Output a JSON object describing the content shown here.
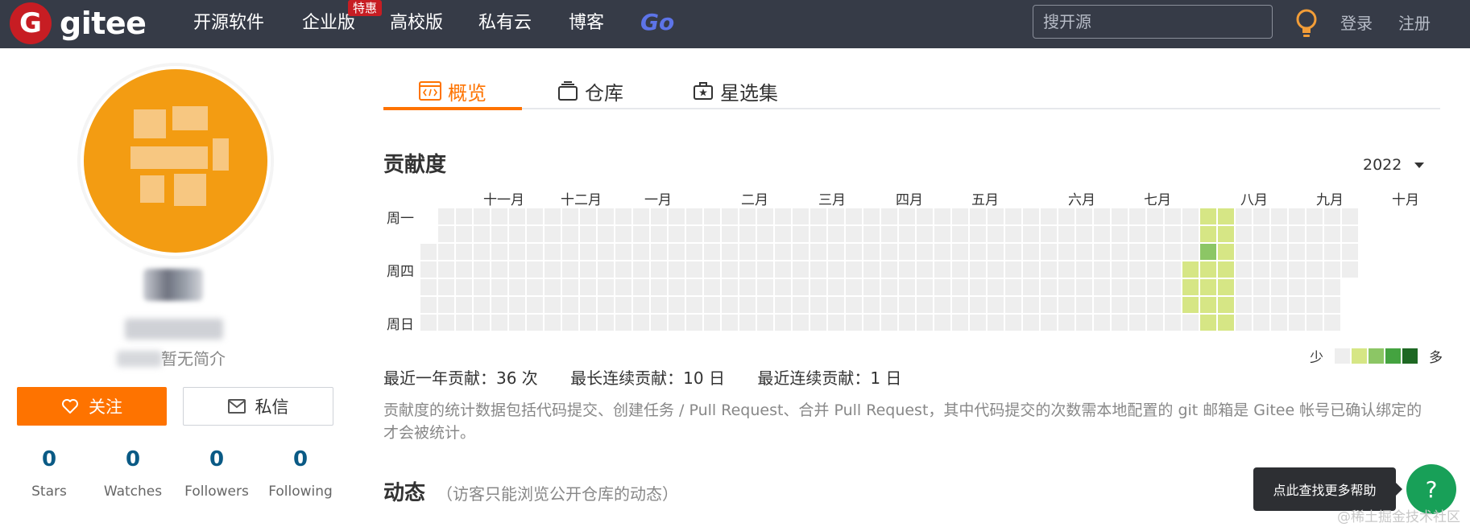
{
  "navbar": {
    "logo_text": "gitee",
    "logo_badge": "G",
    "items": [
      "开源软件",
      "企业版",
      "高校版",
      "私有云",
      "博客"
    ],
    "enterprise_badge": "特惠",
    "go_label": "Go",
    "search_placeholder": "搜开源",
    "login": "登录",
    "register": "注册"
  },
  "profile": {
    "bio": "暂无简介",
    "follow_label": "关注",
    "message_label": "私信",
    "stats": [
      {
        "value": "0",
        "label": "Stars"
      },
      {
        "value": "0",
        "label": "Watches"
      },
      {
        "value": "0",
        "label": "Followers"
      },
      {
        "value": "0",
        "label": "Following"
      }
    ]
  },
  "tabs": [
    {
      "label": "概览",
      "icon": "code-window-icon",
      "active": true
    },
    {
      "label": "仓库",
      "icon": "repo-stack-icon",
      "active": false
    },
    {
      "label": "星选集",
      "icon": "star-collection-icon",
      "active": false
    }
  ],
  "contribution": {
    "title": "贡献度",
    "year": "2022",
    "months": [
      "十一月",
      "十二月",
      "一月",
      "二月",
      "三月",
      "四月",
      "五月",
      "六月",
      "七月",
      "八月",
      "九月",
      "十月"
    ],
    "weekdays": [
      "周一",
      "周四",
      "周日"
    ],
    "legend_less": "少",
    "legend_more": "多",
    "legend_colors": [
      "#eeeeee",
      "#d6e685",
      "#8cc665",
      "#44a340",
      "#1e6823"
    ],
    "stats": {
      "year_total": "最近一年贡献：36 次",
      "longest_streak": "最长连续贡献：10 日",
      "current_streak": "最近连续贡献：1 日"
    },
    "note": "贡献度的统计数据包括代码提交、创建任务 / Pull Request、合并 Pull Request，其中代码提交的次数需本地配置的 git 邮箱是 Gitee 帐号已确认绑定的才会被统计。",
    "heatmap": {
      "weeks": 53,
      "days": 7,
      "active_cells": [
        {
          "week": 43,
          "day": 3,
          "level": 1
        },
        {
          "week": 43,
          "day": 4,
          "level": 1
        },
        {
          "week": 43,
          "day": 5,
          "level": 1
        },
        {
          "week": 44,
          "day": 0,
          "level": 1
        },
        {
          "week": 44,
          "day": 1,
          "level": 1
        },
        {
          "week": 44,
          "day": 2,
          "level": 2
        },
        {
          "week": 44,
          "day": 3,
          "level": 1
        },
        {
          "week": 44,
          "day": 4,
          "level": 1
        },
        {
          "week": 44,
          "day": 5,
          "level": 1
        },
        {
          "week": 44,
          "day": 6,
          "level": 1
        },
        {
          "week": 45,
          "day": 0,
          "level": 1
        },
        {
          "week": 45,
          "day": 1,
          "level": 1
        },
        {
          "week": 45,
          "day": 2,
          "level": 1
        },
        {
          "week": 45,
          "day": 3,
          "level": 1
        },
        {
          "week": 45,
          "day": 4,
          "level": 1
        },
        {
          "week": 45,
          "day": 5,
          "level": 1
        },
        {
          "week": 45,
          "day": 6,
          "level": 1
        }
      ]
    }
  },
  "activity": {
    "title": "动态",
    "subtitle": "（访客只能浏览公开仓库的动态）"
  },
  "help": {
    "tooltip": "点此查找更多帮助",
    "button": "?"
  },
  "watermark": "@稀土掘金技术社区"
}
